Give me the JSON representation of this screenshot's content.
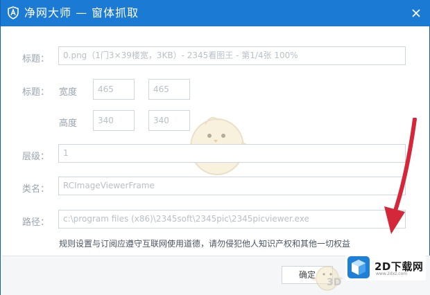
{
  "window": {
    "title": "净网大师 — 窗体抓取"
  },
  "form": {
    "title_label": "标题：",
    "title_value": "0.png（1门3×39楼宽，3KB）- 2345看图王 - 第1/4张 100%",
    "size_label": "标题：",
    "width_label": "宽度",
    "width_value_1": "465",
    "width_value_2": "465",
    "height_label": "高度",
    "height_value_1": "340",
    "height_value_2": "340",
    "level_label": "层级：",
    "level_value": "1",
    "class_label": "类名：",
    "class_value": "RCImageViewerFrame",
    "path_label": "路径：",
    "path_value": "c:\\program files (x86)\\2345soft\\2345pic\\2345picviewer.exe",
    "note": "规则设置与订阅应遵守互联网使用道德，请勿侵犯他人知识产权和其他一切权益"
  },
  "footer": {
    "ok_label": "确定"
  },
  "watermark": {
    "text": "3D",
    "brand": "2D下载网",
    "domain": "www.2dxz.com"
  },
  "colors": {
    "titlebar": "#1b7ad3",
    "arrow": "#d4283a",
    "label": "#9aa3ad"
  }
}
